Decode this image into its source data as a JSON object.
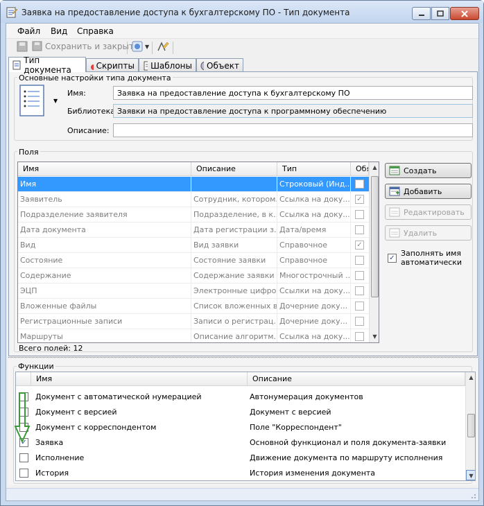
{
  "window": {
    "title": "Заявка на предоставление доступа к бухгалтерскому ПО - Тип документа"
  },
  "menu": [
    "Файл",
    "Вид",
    "Справка"
  ],
  "toolbar": {
    "save_close_label": "Сохранить и закрыть"
  },
  "tabs": [
    {
      "label": "Тип документа",
      "icon": "doctype-icon"
    },
    {
      "label": "Скрипты",
      "icon": "scripts-icon"
    },
    {
      "label": "Шаблоны",
      "icon": "templates-icon"
    },
    {
      "label": "Объект",
      "icon": "object-icon"
    }
  ],
  "basic": {
    "group_label": "Основные настройки типа документа",
    "name_label": "Имя:",
    "name_value": "Заявка на предоставление доступа к бухгалтерскому ПО",
    "library_label": "Библиотека:",
    "library_value": "Заявки на предоставление доступа к программному обеспечению",
    "description_label": "Описание:",
    "description_value": ""
  },
  "fields": {
    "group_label": "Поля",
    "columns": [
      "Имя",
      "Описание",
      "Тип",
      "Обя"
    ],
    "rows": [
      {
        "name": "Имя",
        "desc": "",
        "type": "Строковый (Инд...",
        "req": false,
        "selected": true
      },
      {
        "name": "Заявитель",
        "desc": "Сотрудник, котором...",
        "type": "Ссылка на доку...",
        "req": true,
        "selected": false
      },
      {
        "name": "Подразделение заявителя",
        "desc": "Подразделение, в к...",
        "type": "Ссылка на доку...",
        "req": false,
        "selected": false
      },
      {
        "name": "Дата документа",
        "desc": "Дата регистрации з...",
        "type": "Дата/время",
        "req": false,
        "selected": false
      },
      {
        "name": "Вид",
        "desc": "Вид заявки",
        "type": "Справочное",
        "req": true,
        "selected": false
      },
      {
        "name": "Состояние",
        "desc": "Состояние заявки",
        "type": "Справочное",
        "req": false,
        "selected": false
      },
      {
        "name": "Содержание",
        "desc": "Содержание заявки",
        "type": "Многострочный ...",
        "req": false,
        "selected": false
      },
      {
        "name": "ЭЦП",
        "desc": "Электронные цифро...",
        "type": "Ссылки на доку...",
        "req": false,
        "selected": false
      },
      {
        "name": "Вложенные файлы",
        "desc": "Список вложенных в...",
        "type": "Дочерние доку...",
        "req": false,
        "selected": false
      },
      {
        "name": "Регистрационные записи",
        "desc": "Записи о регистрац...",
        "type": "Дочерние доку...",
        "req": false,
        "selected": false
      },
      {
        "name": "Маршруты",
        "desc": "Описание алгоритм...",
        "type": "Ссылка на доку...",
        "req": false,
        "selected": false
      }
    ],
    "total": "Всего полей: 12",
    "buttons": {
      "create": "Создать",
      "add": "Добавить",
      "edit": "Редактировать",
      "delete": "Удалить"
    },
    "auto_name_label": "Заполнять имя автоматически",
    "auto_name_checked": true
  },
  "functions": {
    "group_label": "Функции",
    "columns": [
      "Имя",
      "Описание"
    ],
    "rows": [
      {
        "name": "Документ с автоматической нумерацией",
        "desc": "Автонумерация документов",
        "checked": false
      },
      {
        "name": "Документ с версией",
        "desc": "Документ с версией",
        "checked": false
      },
      {
        "name": "Документ с корреспондентом",
        "desc": "Поле \"Корреспондент\"",
        "checked": false
      },
      {
        "name": "Заявка",
        "desc": "Основной функционал и поля документа-заявки",
        "checked": true
      },
      {
        "name": "Исполнение",
        "desc": "Движение документа по маршруту исполнения",
        "checked": false
      },
      {
        "name": "История",
        "desc": "История изменения документа",
        "checked": false
      }
    ]
  },
  "colors": {
    "selection": "#3399ff",
    "arrow": "#3a9a3a"
  }
}
